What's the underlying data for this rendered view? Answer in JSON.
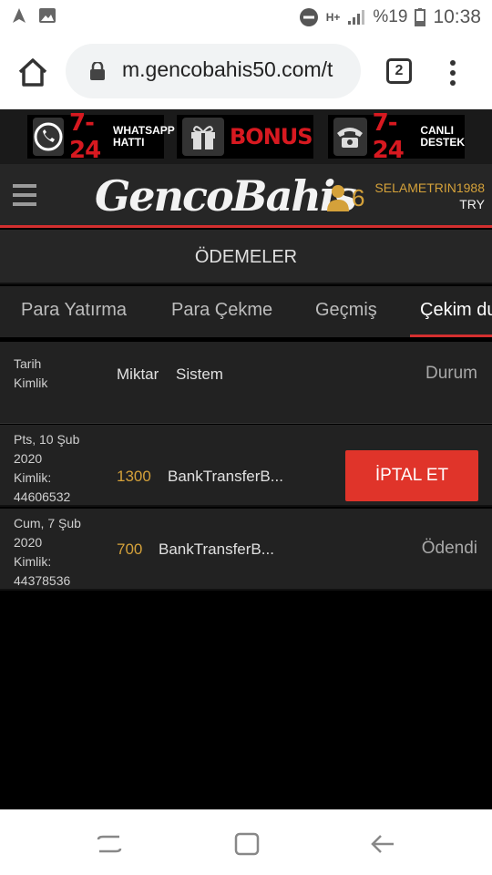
{
  "status_bar": {
    "network": "H+",
    "battery": "%19",
    "time": "10:38"
  },
  "browser": {
    "url": "m.gencobahis50.com/t",
    "tab_count": "2"
  },
  "promo": [
    {
      "icon": "whatsapp-icon",
      "text": "7-24",
      "sub": "WHATSAPP HATTI"
    },
    {
      "icon": "gift-icon",
      "text": "BONUS",
      "sub": ""
    },
    {
      "icon": "phone-icon",
      "text": "7-24",
      "sub": "CANLI DESTEK"
    }
  ],
  "header": {
    "logo": "GencoBahis",
    "user_count": "6",
    "username": "SELAMETRIN1988",
    "currency": "TRY"
  },
  "page_title": "ÖDEMELER",
  "tabs": [
    {
      "label": "Para Yatırma"
    },
    {
      "label": "Para Çekme"
    },
    {
      "label": "Geçmiş"
    },
    {
      "label": "Çekim du"
    }
  ],
  "table": {
    "headers": {
      "date": "Tarih",
      "id": "Kimlik",
      "amount": "Miktar",
      "system": "Sistem",
      "status": "Durum"
    },
    "rows": [
      {
        "date": "Pts, 10 Şub 2020",
        "id_label": "Kimlik:",
        "id": "44606532",
        "amount": "1300",
        "system": "BankTransferB...",
        "action": "İPTAL ET"
      },
      {
        "date": "Cum, 7 Şub 2020",
        "id_label": "Kimlik:",
        "id": "44378536",
        "amount": "700",
        "system": "BankTransferB...",
        "status": "Ödendi"
      }
    ]
  },
  "colors": {
    "accent_red": "#d32f2f",
    "gold": "#d4a13a",
    "panel": "#222222"
  }
}
